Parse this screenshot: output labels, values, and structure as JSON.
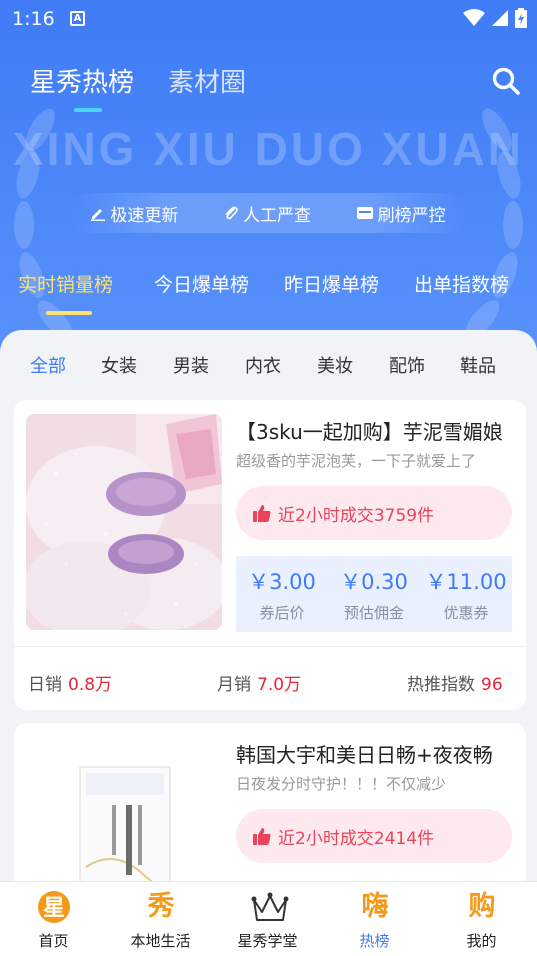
{
  "status_bar": {
    "time": "1:16",
    "notification_letter": "A"
  },
  "header": {
    "tabs": [
      {
        "label": "星秀热榜"
      },
      {
        "label": "素材圈"
      }
    ],
    "active_tab": "星秀热榜",
    "banner_text": "XING XIU DUO XUAN"
  },
  "features": [
    {
      "icon": "pencil-icon",
      "label": "极速更新"
    },
    {
      "icon": "paperclip-icon",
      "label": "人工严查"
    },
    {
      "icon": "shield-icon",
      "label": "刷榜严控"
    }
  ],
  "rank_tabs": [
    {
      "label": "实时销量榜"
    },
    {
      "label": "今日爆单榜"
    },
    {
      "label": "昨日爆单榜"
    },
    {
      "label": "出单指数榜"
    }
  ],
  "categories": [
    {
      "label": "全部"
    },
    {
      "label": "女装"
    },
    {
      "label": "男装"
    },
    {
      "label": "内衣"
    },
    {
      "label": "美妆"
    },
    {
      "label": "配饰"
    },
    {
      "label": "鞋品"
    }
  ],
  "products": [
    {
      "title": "【3sku一起加购】芋泥雪媚娘",
      "desc": "超级香的芋泥泡芙，一下子就爱上了",
      "sales": "近2小时成交3759件",
      "prices": [
        {
          "value": "￥3.00",
          "label": "券后价"
        },
        {
          "value": "￥0.30",
          "label": "预估佣金"
        },
        {
          "value": "￥11.00",
          "label": "优惠券"
        }
      ],
      "stats": [
        {
          "label": "日销",
          "value": "0.8万"
        },
        {
          "label": "月销",
          "value": "7.0万"
        },
        {
          "label": "热推指数",
          "value": "96"
        }
      ]
    },
    {
      "title": "韩国大宇和美日日畅+夜夜畅",
      "desc": "日夜发分时守护！！！不仅减少",
      "sales": "近2小时成交2414件"
    }
  ],
  "bottom_nav": [
    {
      "icon": "星",
      "label": "首页",
      "color": "#f59a18"
    },
    {
      "icon": "秀",
      "label": "本地生活",
      "color": "#f59a18"
    },
    {
      "icon": "crown-icon",
      "label": "星秀学堂",
      "color": "#333333"
    },
    {
      "icon": "嗨",
      "label": "热榜",
      "color": "#f59a18"
    },
    {
      "icon": "购",
      "label": "我的",
      "color": "#f59a18"
    }
  ],
  "colors": {
    "primary": "#3e7bf6",
    "accent_yellow": "#ffe36e",
    "price_red": "#e8263a",
    "sales_pink": "#e8455d",
    "nav_orange": "#f59a18"
  }
}
